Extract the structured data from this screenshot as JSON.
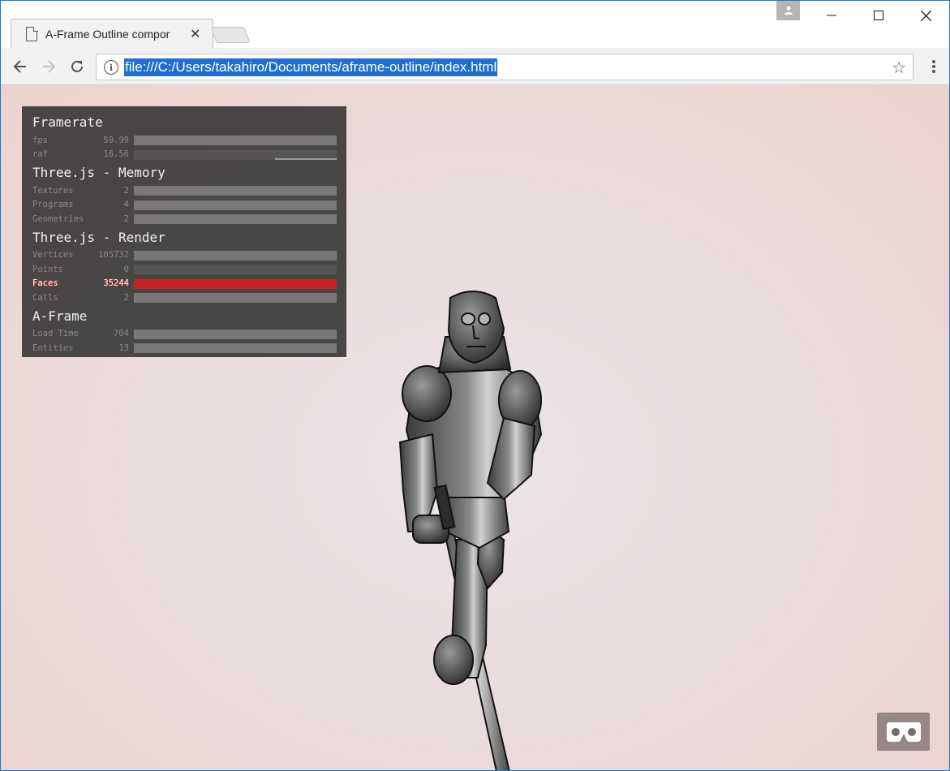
{
  "browser": {
    "tab_title": "A-Frame Outline compor",
    "tab_close": "✕",
    "url": "file:///C:/Users/takahiro/Documents/aframe-outline/index.html",
    "window_controls": {
      "minimize": "—",
      "maximize": "☐",
      "close": "✕"
    }
  },
  "stats": {
    "sections": [
      {
        "title": "Framerate"
      },
      {
        "title": "Three.js - Memory"
      },
      {
        "title": "Three.js - Render"
      },
      {
        "title": "A-Frame"
      }
    ],
    "framerate": [
      {
        "label": "fps",
        "value": "59.99"
      },
      {
        "label": "raf",
        "value": "16.56"
      }
    ],
    "memory": [
      {
        "label": "Textures",
        "value": "2"
      },
      {
        "label": "Programs",
        "value": "4"
      },
      {
        "label": "Geometries",
        "value": "2"
      }
    ],
    "render": [
      {
        "label": "Vertices",
        "value": "105732"
      },
      {
        "label": "Points",
        "value": "0"
      },
      {
        "label": "Faces",
        "value": "35244",
        "alarm": true
      },
      {
        "label": "Calls",
        "value": "2"
      }
    ],
    "aframe": [
      {
        "label": "Load Time",
        "value": "704"
      },
      {
        "label": "Entities",
        "value": "13"
      }
    ],
    "colors": {
      "alarm_bar": "#c62424",
      "panel_bg": "#3c3a3a"
    }
  },
  "scene": {
    "background_colors": [
      "#ebe5e6",
      "#ecd2cf"
    ],
    "model": "armored-knight-with-sword"
  },
  "vr_button": {
    "icon": "vr-headset-icon"
  }
}
